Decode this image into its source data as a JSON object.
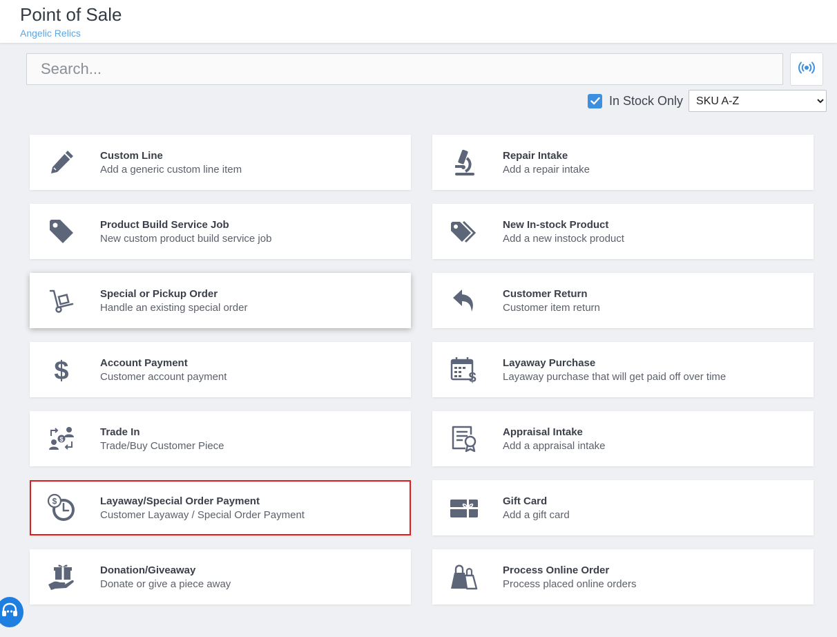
{
  "header": {
    "title": "Point of Sale",
    "store": "Angelic Relics"
  },
  "search": {
    "placeholder": "Search...",
    "value": ""
  },
  "filters": {
    "in_stock_only_label": "In Stock Only",
    "in_stock_only_checked": true,
    "sort_selected": "SKU A-Z",
    "sort_options": [
      "SKU A-Z"
    ]
  },
  "cards": {
    "custom_line": {
      "title": "Custom Line",
      "desc": "Add a generic custom line item",
      "icon": "pencil-icon"
    },
    "repair_intake": {
      "title": "Repair Intake",
      "desc": "Add a repair intake",
      "icon": "microscope-icon"
    },
    "product_build": {
      "title": "Product Build Service Job",
      "desc": "New custom product build service job",
      "icon": "tag-icon"
    },
    "new_instock": {
      "title": "New In-stock Product",
      "desc": "Add a new instock product",
      "icon": "tags-icon"
    },
    "special_order": {
      "title": "Special or Pickup Order",
      "desc": "Handle an existing special order",
      "icon": "dolly-icon"
    },
    "customer_return": {
      "title": "Customer Return",
      "desc": "Customer item return",
      "icon": "reply-arrow-icon"
    },
    "account_payment": {
      "title": "Account Payment",
      "desc": "Customer account payment",
      "icon": "dollar-icon"
    },
    "layaway_purchase": {
      "title": "Layaway Purchase",
      "desc": "Layaway purchase that will get paid off over time",
      "icon": "calendar-dollar-icon"
    },
    "trade_in": {
      "title": "Trade In",
      "desc": "Trade/Buy Customer Piece",
      "icon": "exchange-users-icon"
    },
    "appraisal_intake": {
      "title": "Appraisal Intake",
      "desc": "Add a appraisal intake",
      "icon": "certificate-icon"
    },
    "layaway_payment": {
      "title": "Layaway/Special Order Payment",
      "desc": "Customer Layaway / Special Order Payment",
      "icon": "coin-clock-icon"
    },
    "gift_card": {
      "title": "Gift Card",
      "desc": "Add a gift card",
      "icon": "gift-card-icon"
    },
    "donation": {
      "title": "Donation/Giveaway",
      "desc": "Donate or give a piece away",
      "icon": "hand-gift-icon"
    },
    "online_order": {
      "title": "Process Online Order",
      "desc": "Process placed online orders",
      "icon": "shopping-bag-icon"
    }
  },
  "colors": {
    "accent": "#3d8fe0",
    "icon": "#5d6578",
    "selected_border": "#e31b1b",
    "store_link": "#5aa6e6",
    "help_button": "#1f7fe0"
  }
}
